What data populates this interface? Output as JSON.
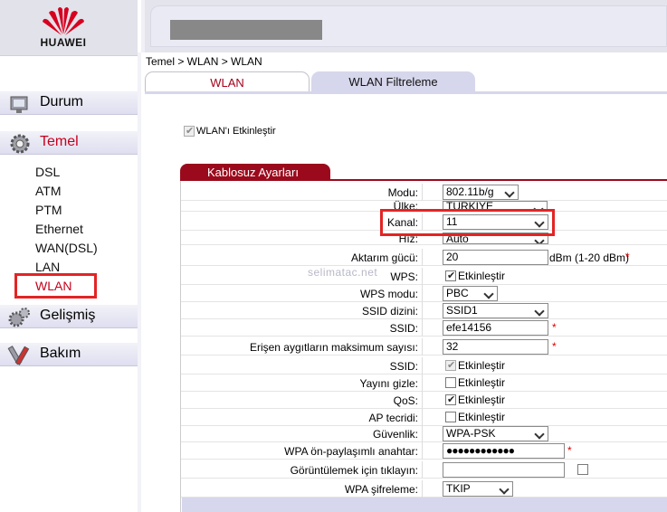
{
  "brand": {
    "name": "HUAWEI",
    "colors": {
      "accent": "#c6001b",
      "section": "#9b0a1c",
      "nav_bg": "#dedef0",
      "highlight": "#e32424"
    }
  },
  "breadcrumb": "Temel > WLAN > WLAN",
  "nav": {
    "durum": {
      "label": "Durum",
      "icon": "monitor-icon"
    },
    "temel": {
      "label": "Temel",
      "icon": "gear-icon"
    },
    "gelismis": {
      "label": "Gelişmiş",
      "icon": "gears-icon"
    },
    "bakim": {
      "label": "Bakım",
      "icon": "tools-icon"
    },
    "temel_items": [
      "DSL",
      "ATM",
      "PTM",
      "Ethernet",
      "WAN(DSL)",
      "LAN",
      "WLAN"
    ],
    "active_item": "WLAN"
  },
  "tabs": [
    "WLAN",
    "WLAN Filtreleme"
  ],
  "enable_label": "WLAN'ı Etkinleştir",
  "section_title": "Kablosuz Ayarları",
  "watermark": "selimatac.net",
  "form": {
    "modu": {
      "label": "Modu:",
      "value": "802.11b/g"
    },
    "ulke": {
      "label": "Ülke:",
      "value": "TURKIYE"
    },
    "kanal": {
      "label": "Kanal:",
      "value": "11"
    },
    "hiz": {
      "label": "Hız:",
      "value": "Auto"
    },
    "aktarim": {
      "label": "Aktarım gücü:",
      "value": "20",
      "unit": "dBm (1-20 dBm)",
      "star": "*"
    },
    "wps": {
      "label": "WPS:",
      "text": "Etkinleştir"
    },
    "wps_modu": {
      "label": "WPS modu:",
      "value": "PBC"
    },
    "ssid_dizini": {
      "label": "SSID dizini:",
      "value": "SSID1"
    },
    "ssid": {
      "label": "SSID:",
      "value": "efe14156",
      "star": "*"
    },
    "max": {
      "label": "Erişen aygıtların maksimum sayısı:",
      "value": "32",
      "star": "*"
    },
    "ssid_en": {
      "label": "SSID:",
      "text": "Etkinleştir"
    },
    "yayini": {
      "label": "Yayını gizle:",
      "text": "Etkinleştir"
    },
    "qos": {
      "label": "QoS:",
      "text": "Etkinleştir"
    },
    "ap": {
      "label": "AP tecridi:",
      "text": "Etkinleştir"
    },
    "guvenlik": {
      "label": "Güvenlik:",
      "value": "WPA-PSK"
    },
    "psk": {
      "label": "WPA ön-paylaşımlı anahtar:",
      "value": "●●●●●●●●●●●●",
      "star": "*"
    },
    "goruntule": {
      "label": "Görüntülemek için tıklayın:",
      "value": ""
    },
    "sifreleme": {
      "label": "WPA şifreleme:",
      "value": "TKIP"
    }
  }
}
